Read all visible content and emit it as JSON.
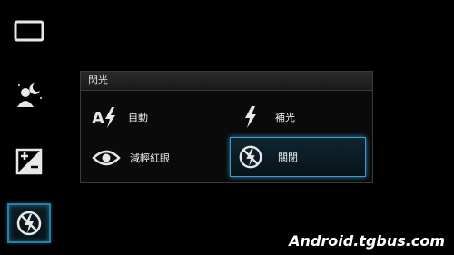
{
  "panel": {
    "title": "閃光",
    "options": [
      {
        "label": "自動",
        "icon": "flash-auto-icon"
      },
      {
        "label": "補光",
        "icon": "flash-on-icon"
      },
      {
        "label": "減輕紅眼",
        "icon": "red-eye-icon"
      },
      {
        "label": "關閉",
        "icon": "flash-off-icon",
        "selected": true
      }
    ]
  },
  "rail": {
    "items": [
      {
        "icon": "picture-size-icon"
      },
      {
        "icon": "scene-night-portrait-icon"
      },
      {
        "icon": "exposure-icon"
      },
      {
        "icon": "flash-off-icon",
        "active": true
      }
    ]
  },
  "watermark": "Android.tgbus.com",
  "colors": {
    "accent": "#3b9ccc",
    "background": "#000000"
  }
}
